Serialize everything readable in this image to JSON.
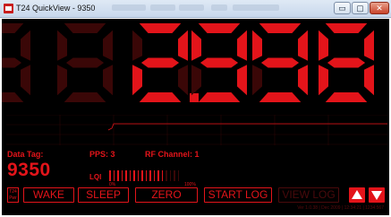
{
  "window": {
    "title": "T24 QuickView - 9350",
    "minimize_symbol": "▭",
    "maximize_symbol": "▢",
    "close_symbol": "✕"
  },
  "display": {
    "digits": [
      {
        "char": "8",
        "lit": false
      },
      {
        "char": "8",
        "lit": false
      },
      {
        "char": "2",
        "lit": true
      },
      {
        "char": "9",
        "lit": true
      },
      {
        "char": "9",
        "lit": true
      },
      {
        "char": "8",
        "lit": true
      }
    ],
    "decimal_after_index": 2,
    "decimal_lit": true,
    "lit_color": "#e3141a",
    "unlit_color": "#3a0707"
  },
  "info": {
    "data_tag_label": "Data Tag:",
    "data_tag_value": "9350",
    "pps_label": "PPS: 3",
    "rf_channel_label": "RF Channel: 1",
    "lqi_label": "LQI",
    "lqi_level_fraction": 0.78,
    "lqi_min_label": "0%",
    "lqi_max_label": "100%"
  },
  "buttons": {
    "sensor_label": "T24 Pwr",
    "wake": "WAKE",
    "sleep": "SLEEP",
    "zero": "ZERO",
    "start_log": "START LOG",
    "view_log": "VIEW LOG",
    "up_icon": "arrow-up-icon",
    "down_icon": "arrow-down-icon"
  },
  "footer": {
    "status_text": "Ver 1.0.38 | Dec 2009 | 12:34:21 | 1234:567"
  }
}
